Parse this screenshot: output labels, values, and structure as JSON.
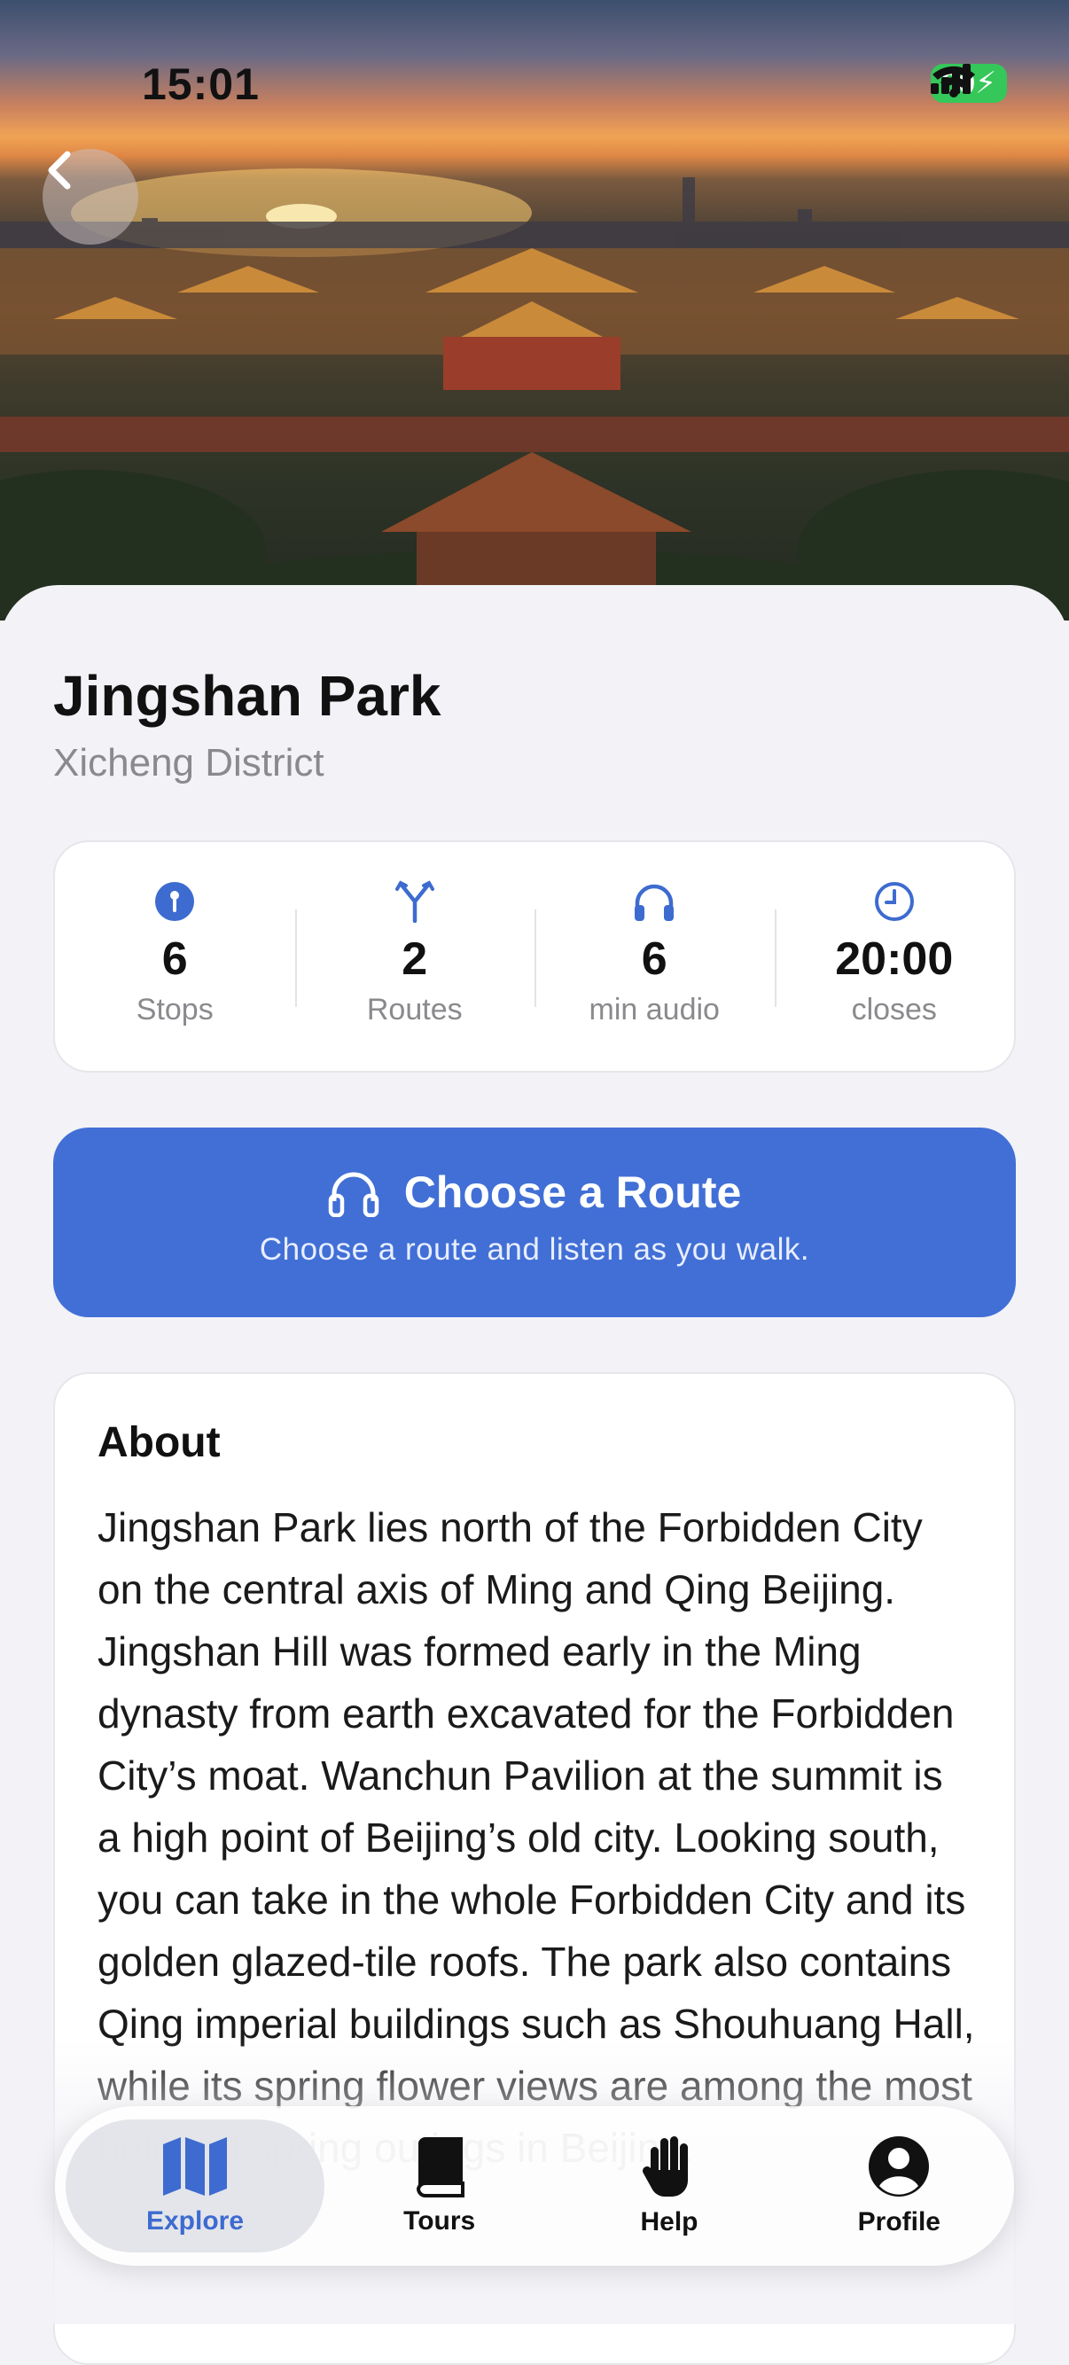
{
  "status_bar": {
    "time": "15:01",
    "battery": "80"
  },
  "place": {
    "name": "Jingshan Park",
    "district": "Xicheng District"
  },
  "stats": [
    {
      "icon": "pin-icon",
      "value": "6",
      "label": "Stops"
    },
    {
      "icon": "fork-icon",
      "value": "2",
      "label": "Routes"
    },
    {
      "icon": "headphones-icon",
      "value": "6",
      "label": "min audio"
    },
    {
      "icon": "clock-icon",
      "value": "20:00",
      "label": "closes"
    }
  ],
  "route_button": {
    "title": "Choose a Route",
    "subtitle": "Choose a route and listen as you walk."
  },
  "about": {
    "title": "About",
    "body": "Jingshan Park lies north of the Forbidden City on the central axis of Ming and Qing Beijing. Jingshan Hill was formed early in the Ming dynasty from earth excavated for the Forbidden City’s moat. Wanchun Pavilion at the summit is a high point of Beijing’s old city. Looking south, you can take in the whole Forbidden City and its golden glazed-tile roofs. The park also contains Qing imperial buildings such as Shouhuang Hall, while its spring flower views are among the most beloved spring outings in Beijing."
  },
  "tabs": [
    {
      "icon": "map-icon",
      "label": "Explore",
      "active": true
    },
    {
      "icon": "book-icon",
      "label": "Tours",
      "active": false
    },
    {
      "icon": "hand-icon",
      "label": "Help",
      "active": false
    },
    {
      "icon": "person-icon",
      "label": "Profile",
      "active": false
    }
  ],
  "colors": {
    "accent": "#416fd6",
    "background": "#f2f2f7",
    "battery": "#35c759"
  }
}
